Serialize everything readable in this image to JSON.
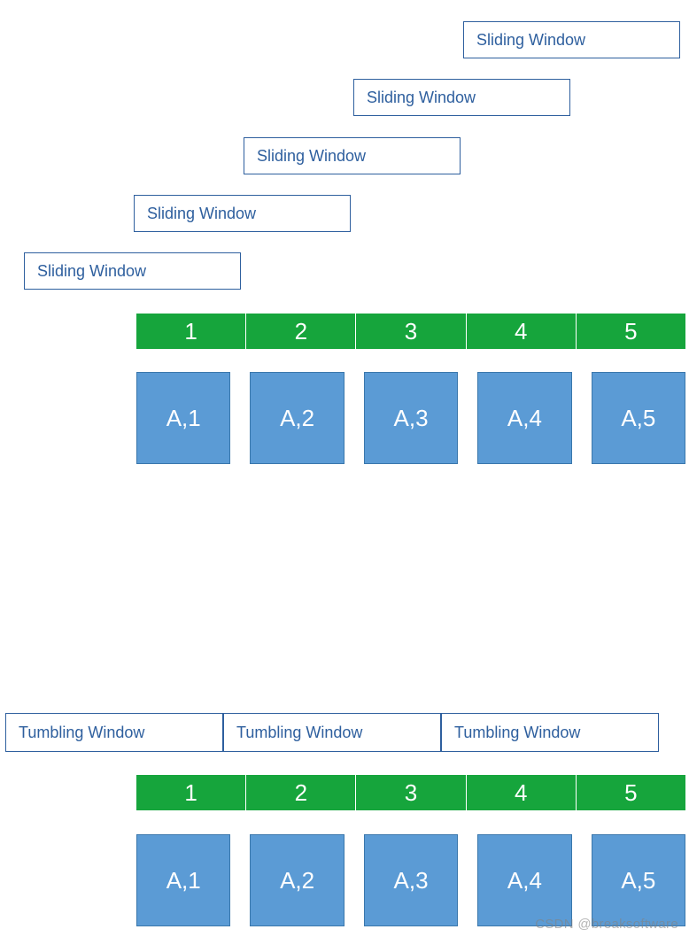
{
  "sliding": {
    "labels": [
      "Sliding Window",
      "Sliding Window",
      "Sliding Window",
      "Sliding Window",
      "Sliding Window"
    ]
  },
  "tumbling": {
    "labels": [
      "Tumbling Window",
      "Tumbling Window",
      "Tumbling Window"
    ]
  },
  "timeline_upper": {
    "cells": [
      "1",
      "2",
      "3",
      "4",
      "5"
    ]
  },
  "data_upper": {
    "cells": [
      "A,1",
      "A,2",
      "A,3",
      "A,4",
      "A,5"
    ]
  },
  "timeline_lower": {
    "cells": [
      "1",
      "2",
      "3",
      "4",
      "5"
    ]
  },
  "data_lower": {
    "cells": [
      "A,1",
      "A,2",
      "A,3",
      "A,4",
      "A,5"
    ]
  },
  "watermark": "CSDN @breaksoftware"
}
